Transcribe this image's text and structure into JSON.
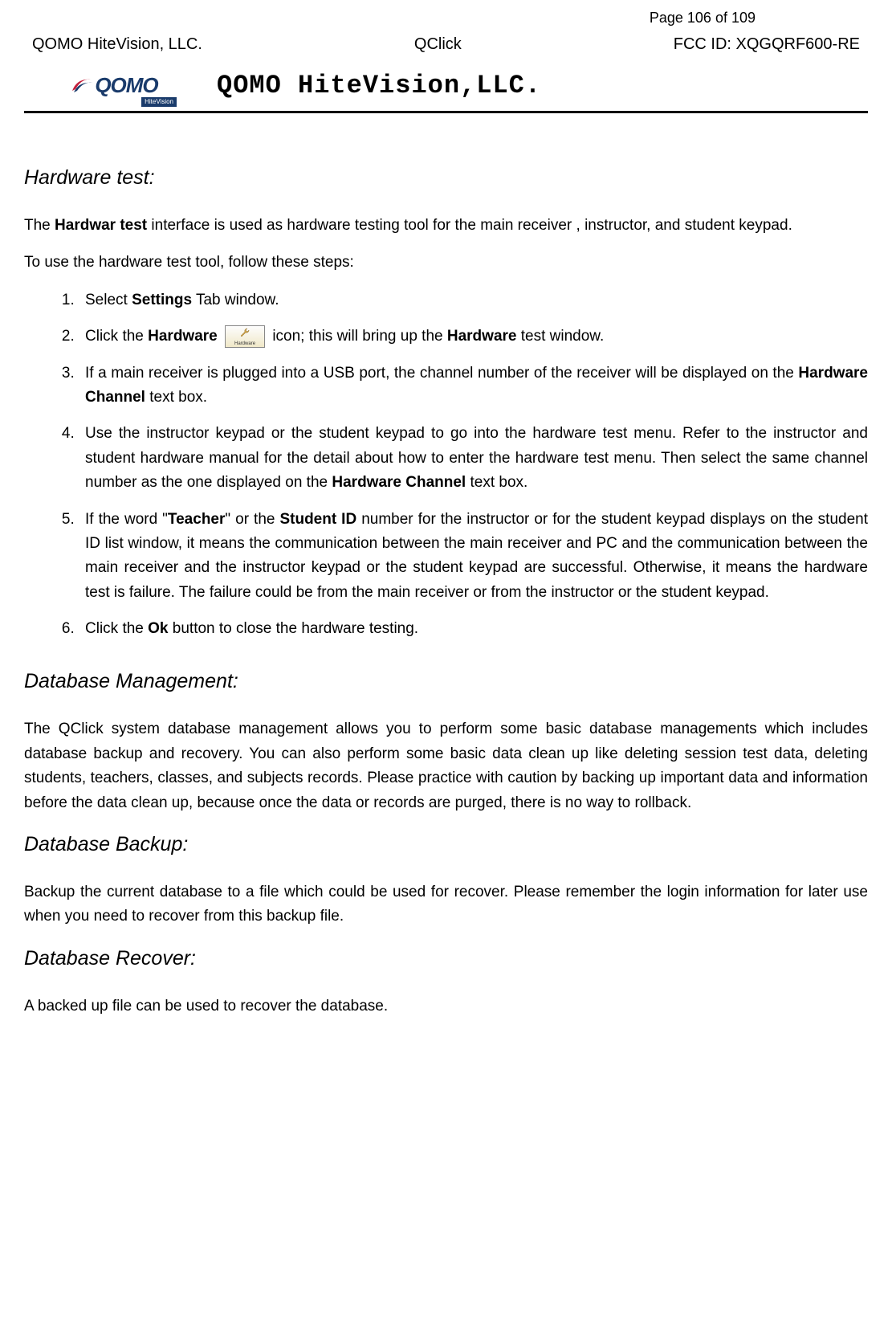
{
  "header": {
    "page_label": "Page 106 of 109",
    "left": "QOMO HiteVision, LLC.",
    "center": "QClick",
    "right": "FCC ID: XQGQRF600-RE",
    "company_title": "QOMO HiteVision,LLC.",
    "logo_main": "QOMO",
    "logo_sub": "HiteVision"
  },
  "sections": {
    "hardware_test": {
      "heading": "Hardware test:",
      "intro_pre": "The  ",
      "intro_bold": "Hardwar test",
      "intro_post": " interface  is  used  as  hardware  testing  tool  for  the  main receiver , instructor, and student keypad.",
      "steps_lead": "To use the hardware test tool, follow these steps:",
      "steps": {
        "s1_pre": "Select ",
        "s1_bold": "Settings",
        "s1_post": " Tab window.",
        "s2_pre": "Click the ",
        "s2_bold1": "Hardware",
        "s2_mid": "  icon; this will bring up the ",
        "s2_bold2": "Hardware",
        "s2_post": " test window.",
        "s2_icon_label": "Hardware",
        "s3_pre": "If a main receiver is plugged into a USB port, the channel number of the receiver will be displayed on the ",
        "s3_bold": "Hardware Channel",
        "s3_post": " text box.",
        "s4_pre": "Use the instructor keypad or the student keypad to go into the hardware test menu. Refer to the instructor and student hardware manual for the detail about how to enter the hardware test menu. Then select the same channel number as the one displayed on the ",
        "s4_bold": "Hardware Channel",
        "s4_post": " text box.",
        "s5_pre": "If the word \"",
        "s5_bold1": "Teacher",
        "s5_mid1": "\" or the ",
        "s5_bold2": "Student ID",
        "s5_post": " number for the instructor or for the student keypad displays on the student ID list window, it means the communication between the main receiver and PC and the communication between the main receiver and the instructor keypad or the student keypad are successful. Otherwise, it means the hardware test is failure. The failure could be from the main receiver or from the instructor or the student keypad.",
        "s6_pre": "Click the ",
        "s6_bold": "Ok",
        "s6_post": " button to close the hardware testing."
      }
    },
    "db_management": {
      "heading": "Database Management:",
      "body": "The QClick system database management  allows  you  to  perform  some  basic  database managements  which  includes  database  backup and  recovery. You can also perform some basic data clean up like deleting session test data, deleting students, teachers, classes, and subjects records. Please practice with caution by backing up important data and information before the data clean up, because once the data or records are purged, there is no way to rollback."
    },
    "db_backup": {
      "heading": "Database Backup:",
      "body": "Backup the current database to a file which could be used for recover. Please remember the login information for later use when you need to recover from this backup file."
    },
    "db_recover": {
      "heading": "Database Recover:",
      "body": "A backed up file can be used to recover the database."
    }
  }
}
